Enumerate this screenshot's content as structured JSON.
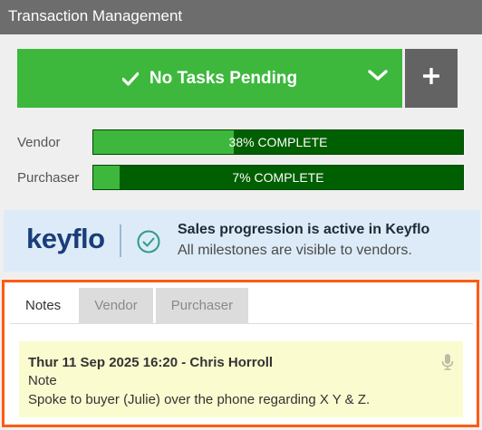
{
  "window": {
    "title": "Transaction Management"
  },
  "tasks": {
    "label": "No Tasks Pending",
    "icon": "check-icon",
    "expand_icon": "chevron-down-icon",
    "add_icon": "plus-icon"
  },
  "progress": [
    {
      "label": "Vendor",
      "percent": 38,
      "text": "38% COMPLETE"
    },
    {
      "label": "Purchaser",
      "percent": 7,
      "text": "7% COMPLETE"
    }
  ],
  "banner": {
    "logo": "keyflo",
    "title": "Sales progression is active in Keyflo",
    "subtitle": "All milestones are visible to vendors.",
    "icon": "check-circle-icon"
  },
  "notes": {
    "tabs": [
      "Notes",
      "Vendor",
      "Purchaser"
    ],
    "active_tab": "Notes",
    "items": [
      {
        "header": "Thur 11 Sep 2025 16:20 - Chris Horroll",
        "type": "Note",
        "body": "Spoke to buyer (Julie) over the phone regarding X Y & Z.",
        "icon": "microphone-icon"
      }
    ]
  },
  "colors": {
    "title_bar": "#6d6d6d",
    "accent_green": "#3db83d",
    "dark_green": "#005f00",
    "banner_bg": "#dcebf7",
    "highlight_border": "#ff5a11",
    "note_bg": "#fbfbd0"
  }
}
